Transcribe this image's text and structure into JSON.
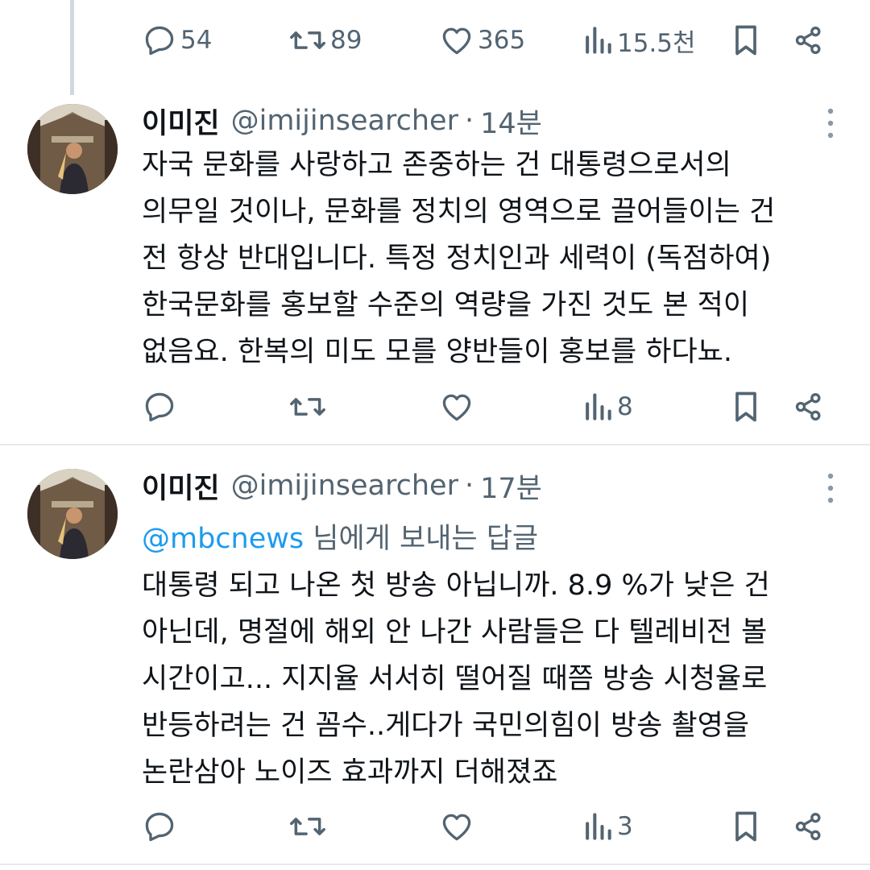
{
  "top_action_bar": {
    "reply_count": "54",
    "retweet_count": "89",
    "like_count": "365",
    "view_count": "15.5천"
  },
  "tweets": [
    {
      "name": "이미진",
      "handle": "@imijinsearcher",
      "separator": "·",
      "time": "14분",
      "lines": [
        "자국 문화를 사랑하고 존중하는 건 대통령으로서의",
        "의무일 것이나, 문화를 정치의 영역으로 끌어들이는 건",
        "전 항상 반대입니다. 특정 정치인과 세력이 (독점하여)",
        "한국문화를 홍보할 수준의 역량을 가진 것도 본 적이",
        "없음요. 한복의 미도 모를 양반들이 홍보를 하다뇨."
      ],
      "view_count": "8"
    },
    {
      "name": "이미진",
      "handle": "@imijinsearcher",
      "separator": "·",
      "time": "17분",
      "reply_to_mention": "@mbcnews",
      "reply_to_suffix": " 님에게 보내는 답글",
      "lines": [
        "대통령 되고 나온 첫 방송 아닙니까. 8.9 %가 낮은 건",
        "아닌데, 명절에 해외 안 나간 사람들은 다 텔레비전 볼",
        "시간이고... 지지율 서서히 떨어질 때쯤 방송 시청율로",
        "반등하려는 건 꼼수..게다가 국민의힘이 방송 촬영을",
        "논란삼아 노이즈 효과까지 더해졌죠"
      ],
      "view_count": "3"
    }
  ],
  "icons": [
    "reply-icon",
    "retweet-icon",
    "like-icon",
    "views-icon",
    "bookmark-icon",
    "share-icon",
    "more-icon"
  ],
  "colors": {
    "text": "#0f1419",
    "secondary": "#536471",
    "link": "#1d9bf0",
    "divider": "#e7e9ec"
  }
}
